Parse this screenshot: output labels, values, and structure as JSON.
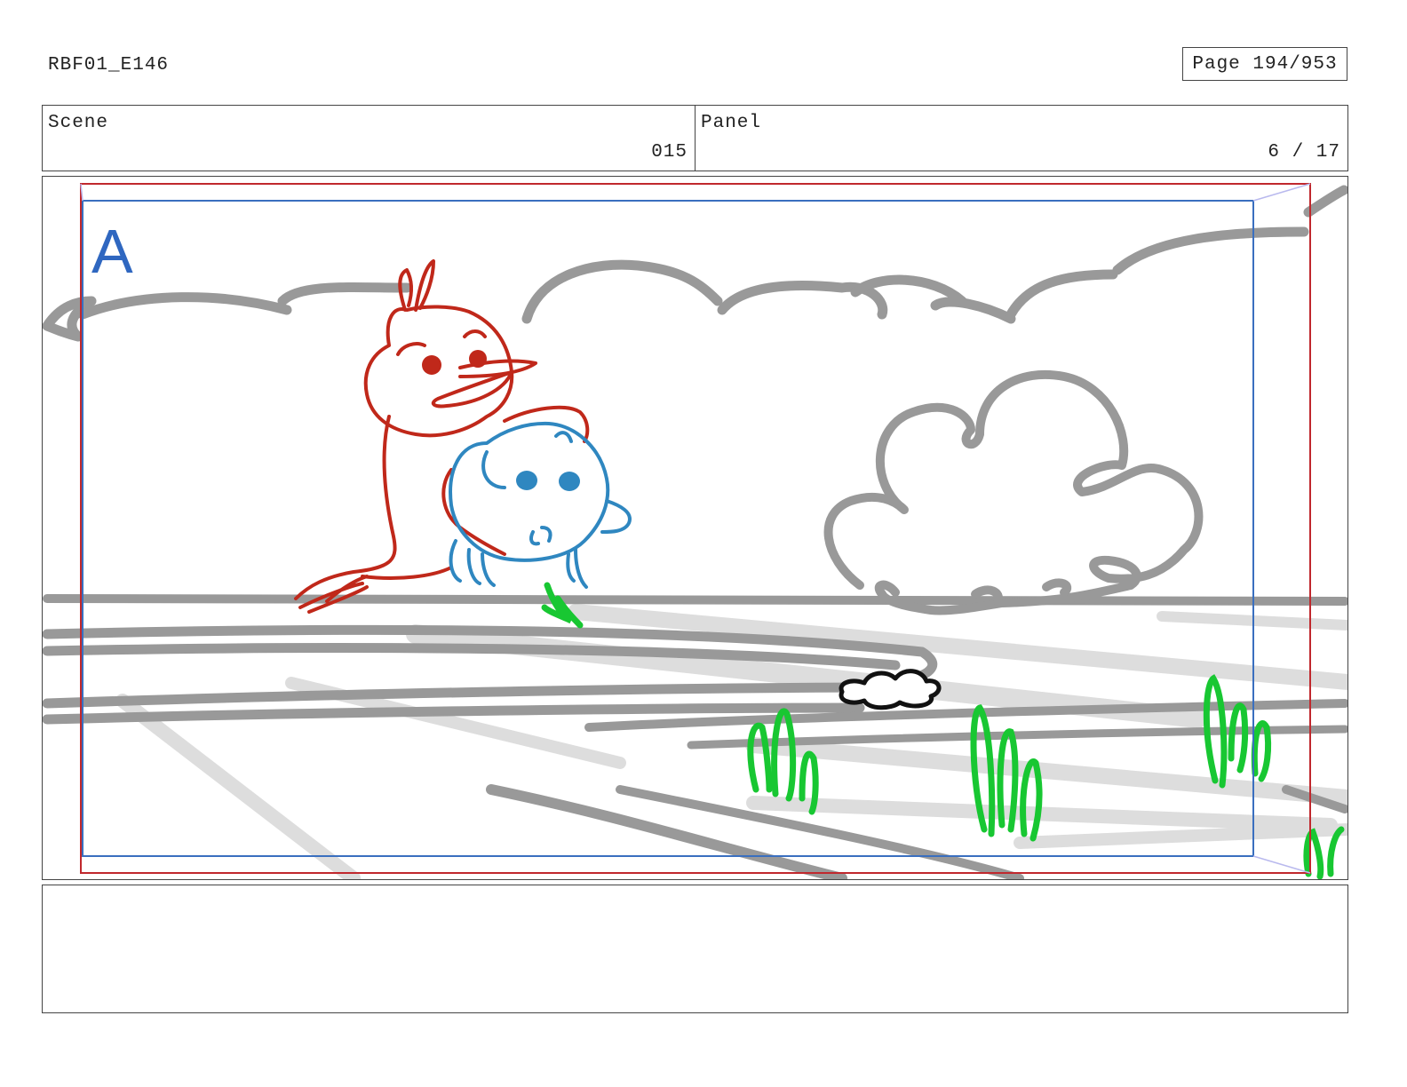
{
  "header": {
    "project_id": "RBF01_E146",
    "page_label": "Page 194/953"
  },
  "info": {
    "scene_label": "Scene",
    "scene_value": "015",
    "panel_label": "Panel",
    "panel_value": "6 / 17"
  },
  "panel": {
    "frame_marker": "A",
    "colors": {
      "outer_guide": "#c0282d",
      "inner_guide": "#3a6fbf",
      "character_red": "#c0281a",
      "character_blue": "#2f87c0",
      "grass": "#18c732",
      "background_lines": "#999999",
      "shadow_lines": "#dcdcdc"
    }
  },
  "notes": {
    "text": ""
  }
}
